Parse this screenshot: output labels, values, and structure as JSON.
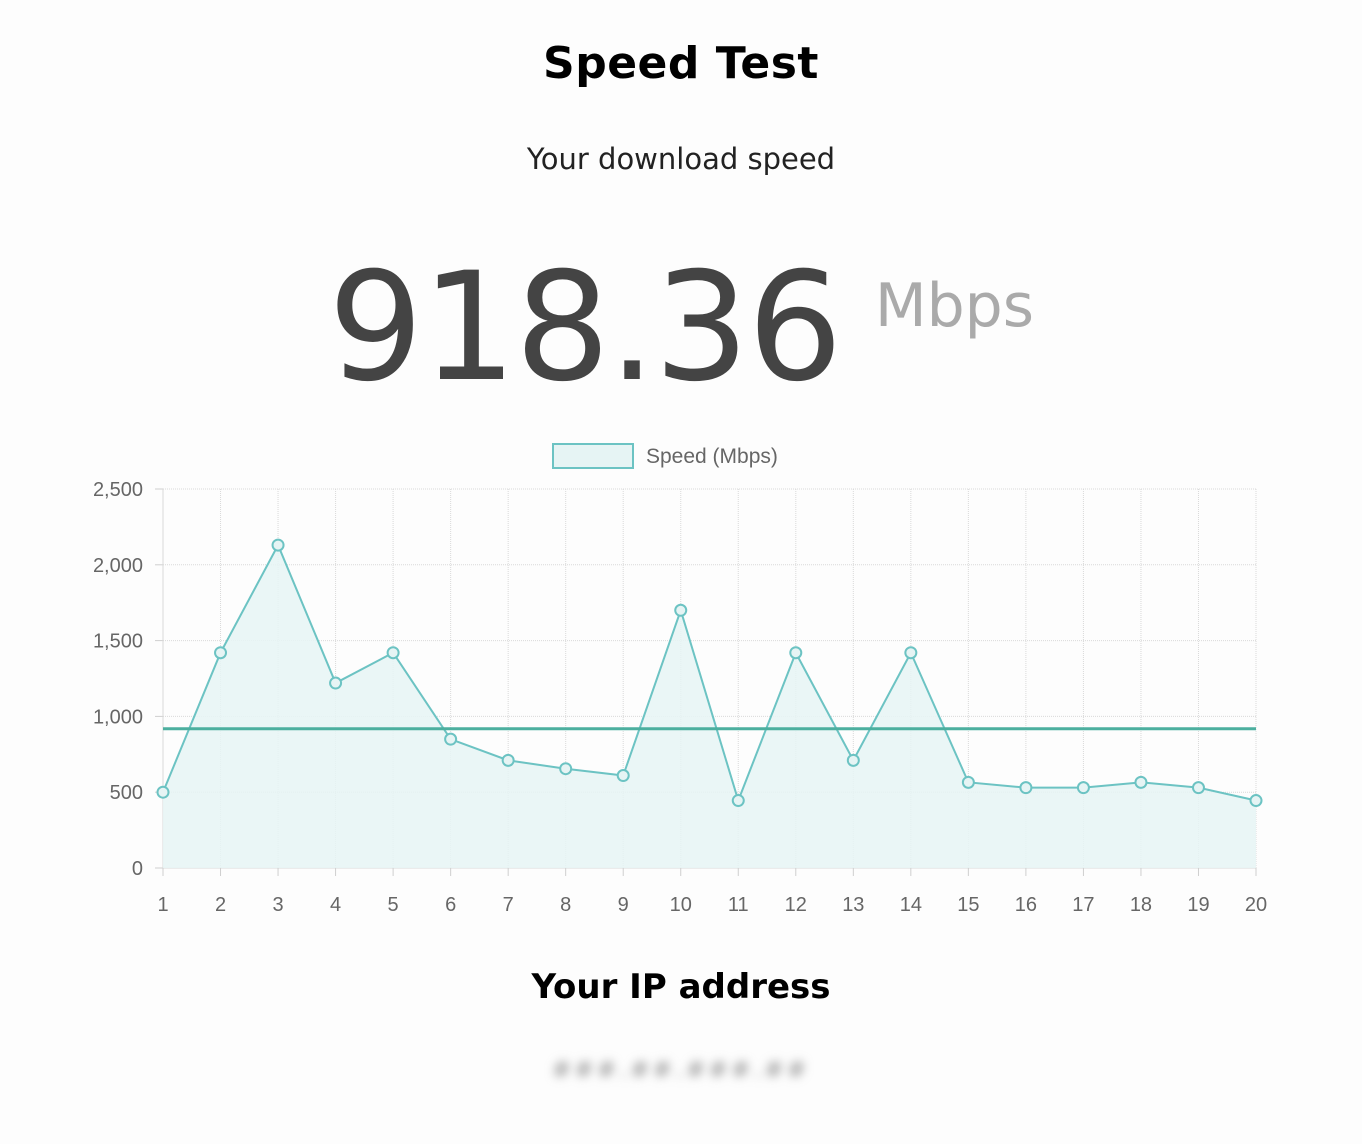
{
  "header": {
    "title": "Speed Test",
    "subtitle": "Your download speed"
  },
  "result": {
    "value": "918.36",
    "unit": "Mbps"
  },
  "chart_data": {
    "type": "line",
    "categories": [
      "1",
      "2",
      "3",
      "4",
      "5",
      "6",
      "7",
      "8",
      "9",
      "10",
      "11",
      "12",
      "13",
      "14",
      "15",
      "16",
      "17",
      "18",
      "19",
      "20"
    ],
    "series": [
      {
        "name": "Speed (Mbps)",
        "values": [
          500,
          1420,
          2130,
          1220,
          1420,
          850,
          710,
          655,
          610,
          1700,
          445,
          1420,
          710,
          1420,
          565,
          530,
          530,
          565,
          530,
          445
        ],
        "color": "#6cc3c3",
        "fill": "#e6f4f4"
      }
    ],
    "reference_line": {
      "value": 918.36,
      "color": "#4caf9f"
    },
    "ylim": [
      0,
      2500
    ],
    "yticks": [
      0,
      500,
      1000,
      1500,
      2000,
      2500
    ],
    "ytick_labels": [
      "0",
      "500",
      "1,000",
      "1,500",
      "2,000",
      "2,500"
    ],
    "grid": true,
    "legend": "top-center"
  },
  "ip": {
    "heading": "Your IP address",
    "value": "###.##.###.##"
  }
}
